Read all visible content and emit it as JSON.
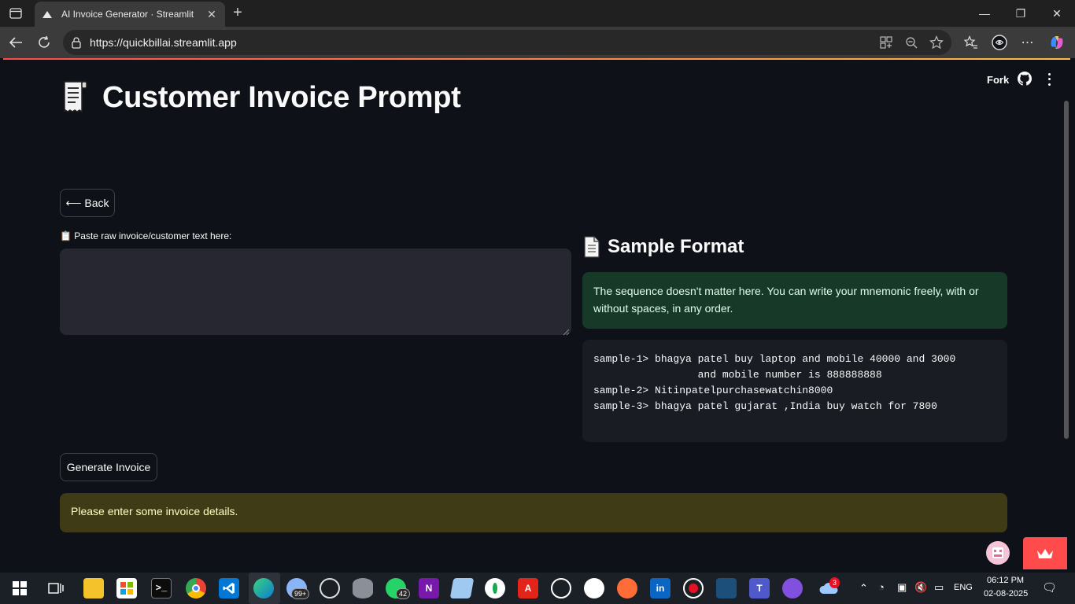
{
  "browser": {
    "tab_title": "AI Invoice Generator · Streamlit",
    "url": "https://quickbillai.streamlit.app"
  },
  "app_header": {
    "fork_label": "Fork"
  },
  "main": {
    "title_emoji": "🧾",
    "title": "Customer Invoice Prompt",
    "back_button": "⟵ Back",
    "input_label": "📋 Paste raw invoice/customer text here:",
    "input_value": "",
    "generate_button": "Generate Invoice",
    "warning": "Please enter some invoice details."
  },
  "sample": {
    "heading": "Sample Format",
    "note": "The sequence doesn't matter here. You can write your mnemonic freely, with or without spaces, in any order.",
    "code_lines": [
      "sample-1> bhagya patel buy laptop and mobile 40000 and 3000",
      "                 and mobile number is 888888888",
      "sample-2> Nitinpatelpurchasewatchin8000",
      "sample-3> bhagya patel gujarat ,India buy watch for 7800"
    ]
  },
  "taskbar": {
    "badges": {
      "chrome_profile": "99+",
      "whatsapp": "42",
      "weather": "3"
    },
    "language": "ENG",
    "time": "06:12 PM",
    "date": "02-08-2025"
  },
  "colors": {
    "page_bg": "#0e1117",
    "accent": "#ff4b4b",
    "success_bg": "#173928",
    "warning_bg": "#3e3b16"
  }
}
